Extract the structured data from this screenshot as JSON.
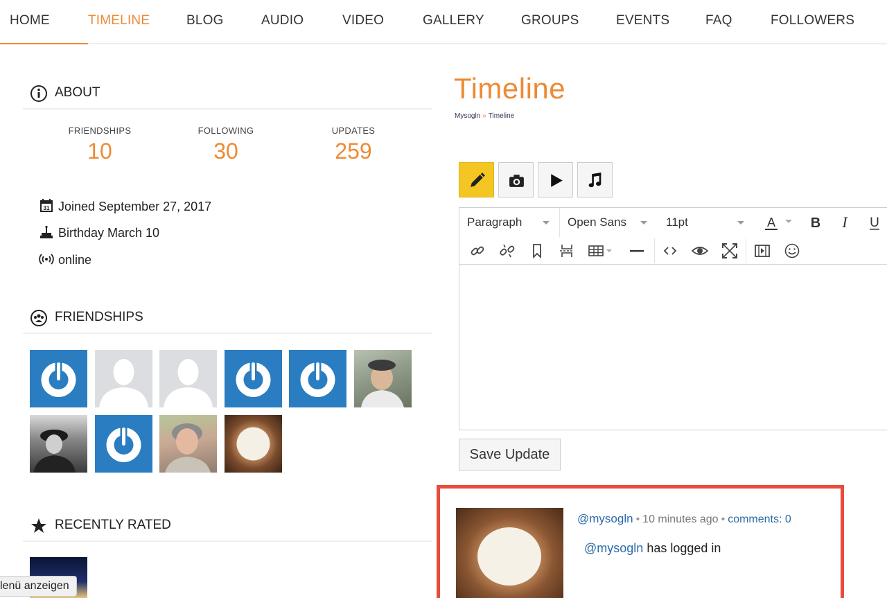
{
  "nav": {
    "items": [
      "HOME",
      "TIMELINE",
      "BLOG",
      "AUDIO",
      "VIDEO",
      "GALLERY",
      "GROUPS",
      "EVENTS",
      "FAQ",
      "FOLLOWERS"
    ],
    "active": "TIMELINE",
    "accent": "#ee8a34"
  },
  "about": {
    "title": "ABOUT",
    "stats": [
      {
        "label": "FRIENDSHIPS",
        "value": "10"
      },
      {
        "label": "FOLLOWING",
        "value": "30"
      },
      {
        "label": "UPDATES",
        "value": "259"
      }
    ],
    "joined": "Joined September 27, 2017",
    "birthday": "Birthday March 10",
    "status": "online"
  },
  "friendships": {
    "title": "FRIENDSHIPS"
  },
  "rated": {
    "title": "RECENTLY RATED"
  },
  "page": {
    "title": "Timeline",
    "breadcrumb_home": "Mysogln",
    "breadcrumb_sep": "»",
    "breadcrumb_current": "Timeline"
  },
  "editor": {
    "format": "Paragraph",
    "font": "Open Sans",
    "size": "11pt",
    "save_label": "Save Update"
  },
  "post": {
    "user": "@mysogln",
    "time": "10 minutes ago",
    "comments": "comments: 0",
    "body_user": "@mysogln",
    "body_text": " has logged in",
    "border_color": "#e84c3d"
  },
  "menu_toggle": "lenü anzeigen"
}
